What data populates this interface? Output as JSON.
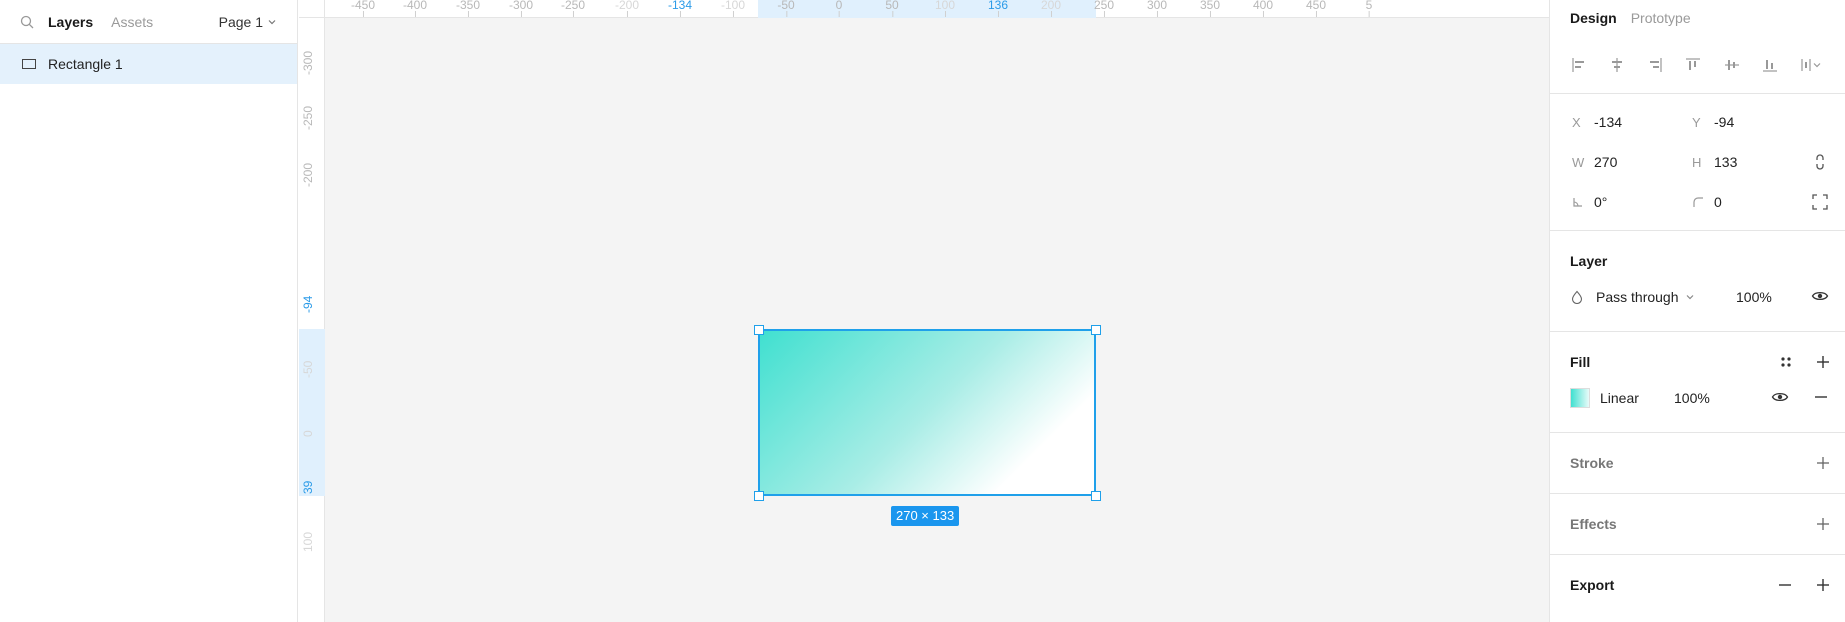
{
  "left_panel": {
    "tabs": [
      "Layers",
      "Assets"
    ],
    "page_selector": "Page 1",
    "layers": [
      {
        "name": "Rectangle 1"
      }
    ]
  },
  "canvas": {
    "top_ruler": [
      {
        "label": "-450"
      },
      {
        "label": "-400"
      },
      {
        "label": "-350"
      },
      {
        "label": "-300"
      },
      {
        "label": "-250"
      },
      {
        "label": "-200",
        "faint": true
      },
      {
        "label": "-134",
        "selected": true
      },
      {
        "label": "-100",
        "faint": true
      },
      {
        "label": "-50"
      },
      {
        "label": "0"
      },
      {
        "label": "50"
      },
      {
        "label": "100",
        "faint": true
      },
      {
        "label": "136",
        "selected": true
      },
      {
        "label": "200",
        "faint": true
      },
      {
        "label": "250"
      },
      {
        "label": "300"
      },
      {
        "label": "350"
      },
      {
        "label": "400"
      },
      {
        "label": "450"
      },
      {
        "label": "5"
      }
    ],
    "left_ruler": [
      {
        "label": "-300"
      },
      {
        "label": "-250"
      },
      {
        "label": "-200"
      },
      {
        "label": "-94",
        "selected": true
      },
      {
        "label": "-50",
        "faint": true
      },
      {
        "label": "0",
        "faint": true
      },
      {
        "label": "39",
        "selected": true
      },
      {
        "label": "100",
        "faint": true
      }
    ],
    "dimension_badge": "270 × 133",
    "shape_fill": {
      "type": "linear",
      "from": "#40e0d0",
      "to": "#ffffff"
    },
    "selection_color": "#1fa0ea"
  },
  "right_panel": {
    "tabs": {
      "design": "Design",
      "prototype": "Prototype"
    },
    "props": {
      "x_label": "X",
      "x": "-134",
      "y_label": "Y",
      "y": "-94",
      "w_label": "W",
      "w": "270",
      "h_label": "H",
      "h": "133",
      "rotation": "0°",
      "radius": "0"
    },
    "layer": {
      "title": "Layer",
      "blend_mode": "Pass through",
      "opacity": "100%"
    },
    "fill": {
      "title": "Fill",
      "type": "Linear",
      "opacity": "100%"
    },
    "stroke": {
      "title": "Stroke"
    },
    "effects": {
      "title": "Effects"
    },
    "export": {
      "title": "Export"
    }
  }
}
